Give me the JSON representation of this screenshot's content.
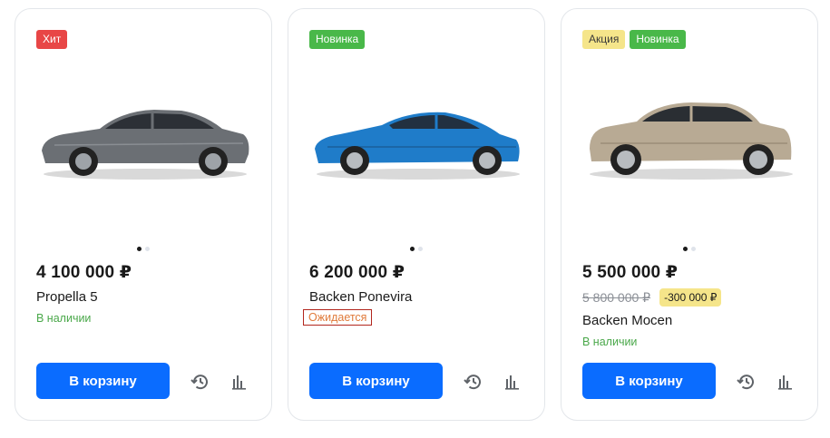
{
  "products": [
    {
      "badges": [
        {
          "label": "Хит",
          "type": "hit"
        }
      ],
      "price": "4 100 000 ₽",
      "name": "Propella 5",
      "status": "В наличии",
      "cart_label": "В корзину",
      "car_color": "#6b6f74"
    },
    {
      "badges": [
        {
          "label": "Новинка",
          "type": "new"
        }
      ],
      "price": "6 200 000 ₽",
      "name": "Backen Ponevira",
      "status": "Ожидается",
      "cart_label": "В корзину",
      "car_color": "#1f7cc9"
    },
    {
      "badges": [
        {
          "label": "Акция",
          "type": "sale"
        },
        {
          "label": "Новинка",
          "type": "new"
        }
      ],
      "price": "5 500 000 ₽",
      "old_price": "5 800 000 ₽",
      "discount": "-300 000 ₽",
      "name": "Backen Mocen",
      "status": "В наличии",
      "cart_label": "В корзину",
      "car_color": "#b8aa94"
    }
  ],
  "colors": {
    "accent": "#0a6cff",
    "hit": "#e84646",
    "new": "#49b849",
    "sale": "#f5e58a",
    "in_stock": "#4aa84a",
    "expected": "#e07a3a"
  },
  "icons": [
    "history-icon",
    "compare-icon"
  ]
}
